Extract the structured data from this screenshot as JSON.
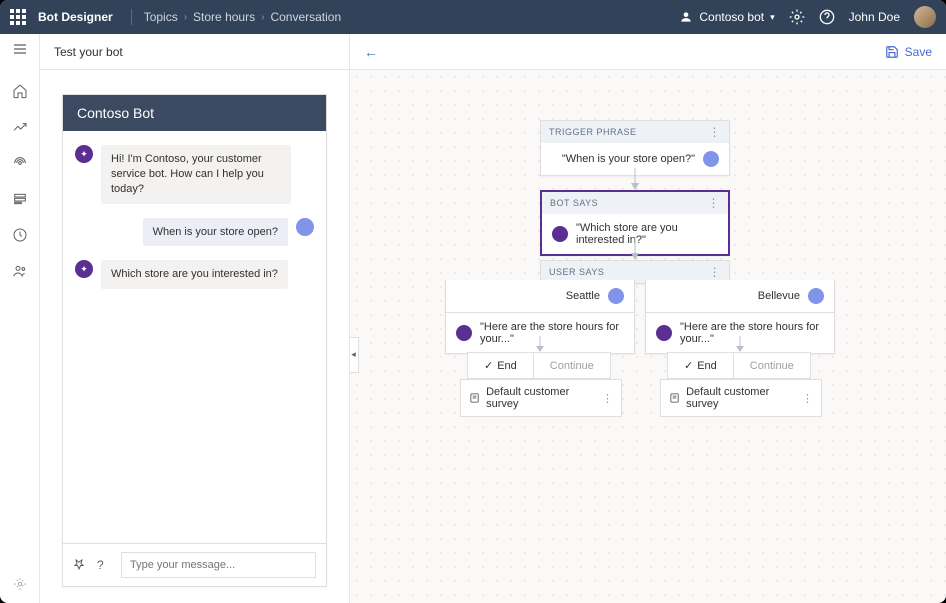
{
  "header": {
    "app_title": "Bot Designer",
    "breadcrumb": [
      "Topics",
      "Store hours",
      "Conversation"
    ],
    "bot_selector": "Contoso bot",
    "user_name": "John Doe"
  },
  "toolbar": {
    "save_label": "Save"
  },
  "test_panel": {
    "title": "Test your bot",
    "chat_title": "Contoso Bot",
    "messages": [
      {
        "role": "bot",
        "text": "Hi! I'm Contoso, your customer service bot. How can I help you today?"
      },
      {
        "role": "user",
        "text": "When is your store open?"
      },
      {
        "role": "bot",
        "text": "Which store are you interested in?"
      }
    ],
    "input_placeholder": "Type your message..."
  },
  "canvas": {
    "trigger": {
      "label": "TRIGGER PHRASE",
      "text": "\"When is your store open?\""
    },
    "bot_says": {
      "label": "BOT SAYS",
      "text": "\"Which store are you interested in?\""
    },
    "user_says": {
      "label": "USER SAYS"
    },
    "branches": [
      {
        "option": "Seattle",
        "response": "\"Here are the store hours for your...\"",
        "end_label": "End",
        "continue_label": "Continue",
        "survey_label": "Default customer survey"
      },
      {
        "option": "Bellevue",
        "response": "\"Here are the store hours for your...\"",
        "end_label": "End",
        "continue_label": "Continue",
        "survey_label": "Default customer survey"
      }
    ]
  }
}
